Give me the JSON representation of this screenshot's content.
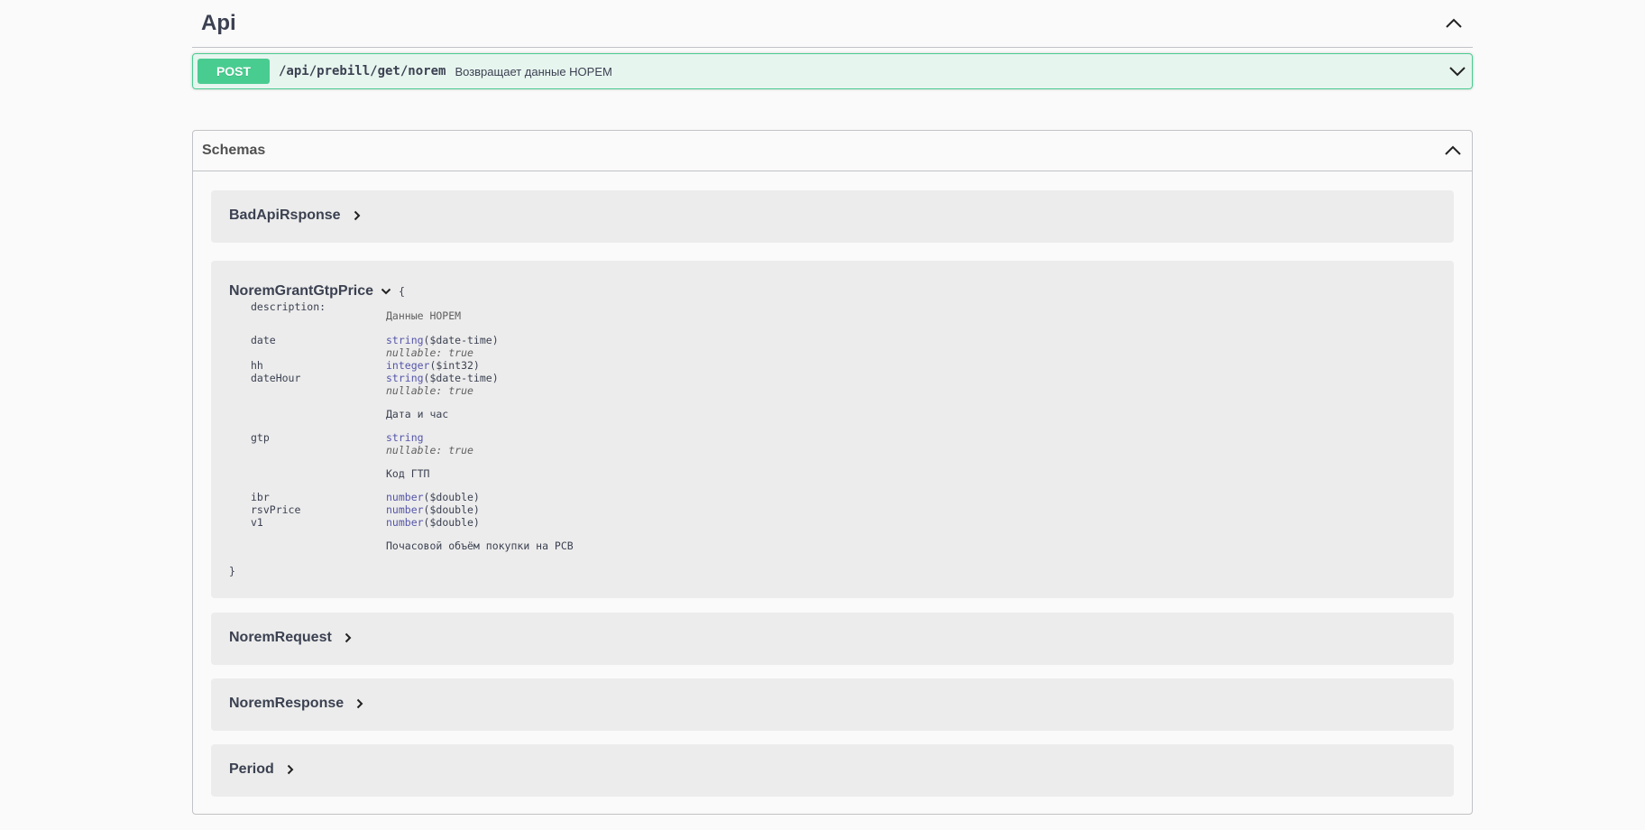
{
  "tag": {
    "title": "Api"
  },
  "operation": {
    "method": "POST",
    "path": "/api/prebill/get/norem",
    "summary": "Возвращает данные НОРЕМ"
  },
  "schemas": {
    "title": "Schemas",
    "models": [
      {
        "name": "BadApiRsponse"
      },
      {
        "name": "NoremGrantGtpPrice",
        "open_brace": "{",
        "close_brace": "}",
        "description_label": "description:",
        "description": "Данные НОРЕМ",
        "properties": [
          {
            "name": "date",
            "type": "string",
            "format": "($date-time)",
            "nullable": "nullable: true"
          },
          {
            "name": "hh",
            "type": "integer",
            "format": "($int32)"
          },
          {
            "name": "dateHour",
            "type": "string",
            "format": "($date-time)",
            "nullable": "nullable: true",
            "description": "Дата и час"
          },
          {
            "name": "gtp",
            "type": "string",
            "nullable": "nullable: true",
            "description": "Код ГТП"
          },
          {
            "name": "ibr",
            "type": "number",
            "format": "($double)"
          },
          {
            "name": "rsvPrice",
            "type": "number",
            "format": "($double)"
          },
          {
            "name": "v1",
            "type": "number",
            "format": "($double)",
            "description": "Почасовой объём покупки на РСВ"
          }
        ]
      },
      {
        "name": "NoremRequest"
      },
      {
        "name": "NoremResponse"
      },
      {
        "name": "Period"
      }
    ]
  }
}
